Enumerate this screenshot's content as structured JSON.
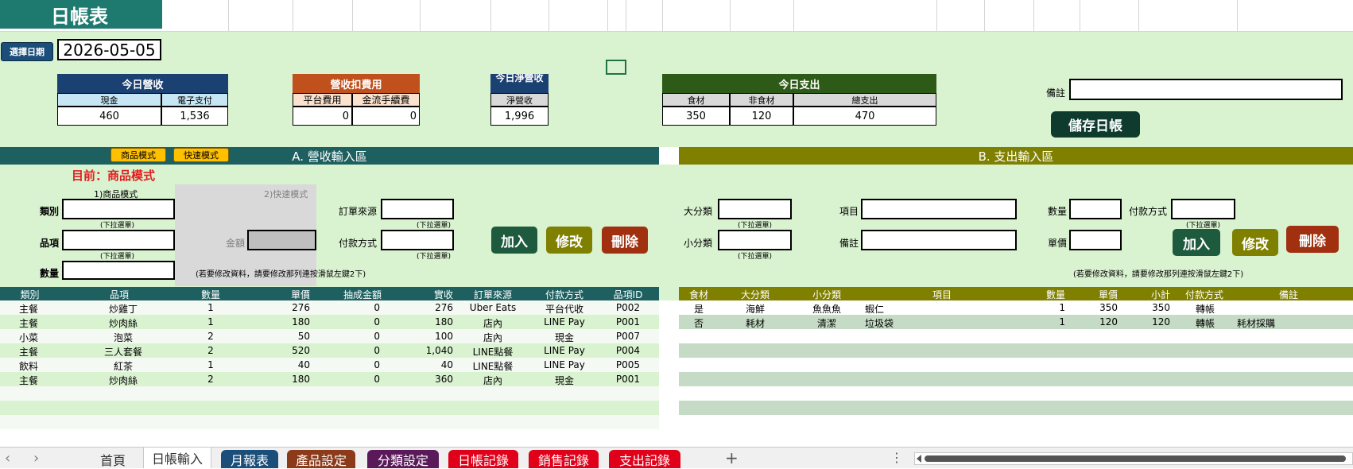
{
  "title": "日帳表",
  "date_button": "選擇日期",
  "date_value": "2026-05-05",
  "revenue": {
    "title": "今日營收",
    "col1": "現金",
    "col2": "電子支付",
    "v1": "460",
    "v2": "1,536"
  },
  "deduct": {
    "title": "營收扣費用",
    "col1": "平台費用",
    "col2": "金流手續費",
    "v1": "0",
    "v2": "0"
  },
  "net": {
    "title": "今日淨營收",
    "col1": "淨營收",
    "v1": "1,996"
  },
  "expense": {
    "title": "今日支出",
    "col1": "食材",
    "col2": "非食材",
    "col3": "總支出",
    "v1": "350",
    "v2": "120",
    "v3": "470"
  },
  "note_label": "備註",
  "save_button": "儲存日帳",
  "section_a": {
    "title": "A. 營收輸入區",
    "mode_btn1": "商品模式",
    "mode_btn2": "快速模式",
    "current_mode": "目前：商品模式",
    "mode1_label": "1)商品模式",
    "mode2_label": "2)快速模式",
    "category": "類別",
    "item": "品項",
    "qty": "數量",
    "amount": "金額",
    "order_source": "訂單來源",
    "pay_method": "付款方式",
    "dropdown_hint": "(下拉選單)",
    "edit_hint": "(若要修改資料，請要修改那列連按滑鼠左鍵2下)",
    "add": "加入",
    "edit": "修改",
    "delete": "刪除"
  },
  "section_b": {
    "title": "B. 支出輸入區",
    "major": "大分類",
    "minor": "小分類",
    "item": "項目",
    "note": "備註",
    "qty": "數量",
    "price": "單價",
    "pay_method": "付款方式",
    "dropdown_hint": "(下拉選單)",
    "edit_hint": "(若要修改資料，請要修改那列連按滑鼠左鍵2下)",
    "add": "加入",
    "edit": "修改",
    "delete": "刪除"
  },
  "table_a": {
    "headers": [
      "類別",
      "品項",
      "數量",
      "單價",
      "抽成金額",
      "實收",
      "訂單來源",
      "付款方式",
      "品項ID"
    ],
    "rows": [
      [
        "主餐",
        "炒雞丁",
        "1",
        "276",
        "0",
        "276",
        "Uber Eats",
        "平台代收",
        "P002"
      ],
      [
        "主餐",
        "炒肉絲",
        "1",
        "180",
        "0",
        "180",
        "店內",
        "LINE Pay",
        "P001"
      ],
      [
        "小菜",
        "泡菜",
        "2",
        "50",
        "0",
        "100",
        "店內",
        "現金",
        "P007"
      ],
      [
        "主餐",
        "三人套餐",
        "2",
        "520",
        "0",
        "1,040",
        "LINE點餐",
        "LINE Pay",
        "P004"
      ],
      [
        "飲料",
        "紅茶",
        "1",
        "40",
        "0",
        "40",
        "LINE點餐",
        "LINE Pay",
        "P005"
      ],
      [
        "主餐",
        "炒肉絲",
        "2",
        "180",
        "0",
        "360",
        "店內",
        "現金",
        "P001"
      ]
    ]
  },
  "table_b": {
    "headers": [
      "食材",
      "大分類",
      "小分類",
      "項目",
      "數量",
      "單價",
      "小計",
      "付款方式",
      "備註"
    ],
    "rows": [
      [
        "是",
        "海鮮",
        "魚魚魚",
        "蝦仁",
        "1",
        "350",
        "350",
        "轉帳",
        ""
      ],
      [
        "否",
        "耗材",
        "清潔",
        "垃圾袋",
        "1",
        "120",
        "120",
        "轉帳",
        "耗材採購"
      ]
    ]
  },
  "tabs": [
    "首頁",
    "日帳輸入",
    "月報表",
    "產品設定",
    "分類設定",
    "日帳記錄",
    "銷售記錄",
    "支出記錄"
  ],
  "nav_prev": "‹",
  "nav_next": "›",
  "add_sheet": "+",
  "more": "⋮"
}
